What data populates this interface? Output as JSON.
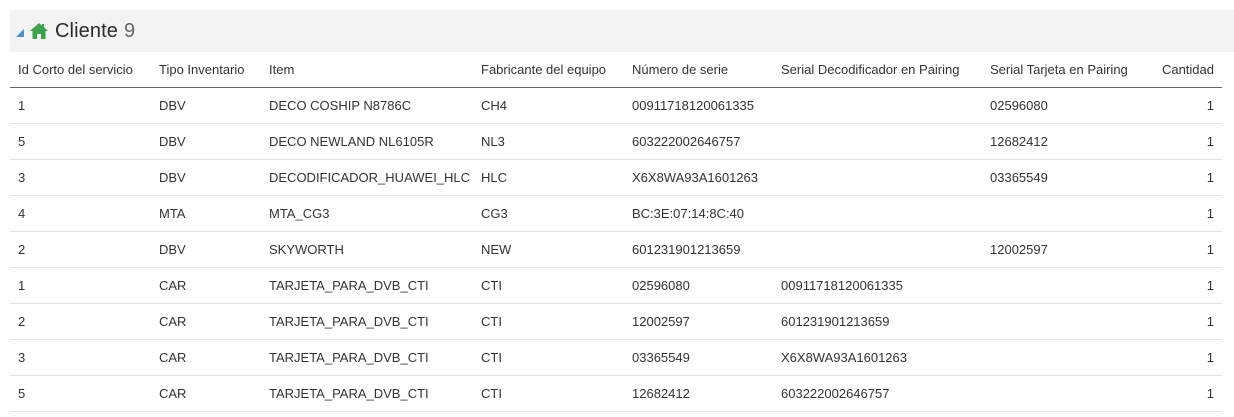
{
  "header": {
    "title": "Cliente",
    "count": "9",
    "icon": "home-icon",
    "icon_color": "#3aa24a",
    "toggle_color": "#4a90c8"
  },
  "table": {
    "columns": [
      "Id Corto del servicio",
      "Tipo Inventario",
      "Item",
      "Fabricante del equipo",
      "Número de serie",
      "Serial Decodificador en Pairing",
      "Serial Tarjeta en Pairing",
      "Cantidad"
    ],
    "rows": [
      [
        "1",
        "DBV",
        "DECO COSHIP N8786C",
        "CH4",
        "00911718120061335",
        "",
        "02596080",
        "1"
      ],
      [
        "5",
        "DBV",
        "DECO NEWLAND NL6105R",
        "NL3",
        "603222002646757",
        "",
        "12682412",
        "1"
      ],
      [
        "3",
        "DBV",
        "DECODIFICADOR_HUAWEI_HLC",
        "HLC",
        "X6X8WA93A1601263",
        "",
        "03365549",
        "1"
      ],
      [
        "4",
        "MTA",
        "MTA_CG3",
        "CG3",
        "BC:3E:07:14:8C:40",
        "",
        "",
        "1"
      ],
      [
        "2",
        "DBV",
        "SKYWORTH",
        "NEW",
        "601231901213659",
        "",
        "12002597",
        "1"
      ],
      [
        "1",
        "CAR",
        "TARJETA_PARA_DVB_CTI",
        "CTI",
        "02596080",
        "00911718120061335",
        "",
        "1"
      ],
      [
        "2",
        "CAR",
        "TARJETA_PARA_DVB_CTI",
        "CTI",
        "12002597",
        "601231901213659",
        "",
        "1"
      ],
      [
        "3",
        "CAR",
        "TARJETA_PARA_DVB_CTI",
        "CTI",
        "03365549",
        "X6X8WA93A1601263",
        "",
        "1"
      ],
      [
        "5",
        "CAR",
        "TARJETA_PARA_DVB_CTI",
        "CTI",
        "12682412",
        "603222002646757",
        "",
        "1"
      ]
    ]
  }
}
